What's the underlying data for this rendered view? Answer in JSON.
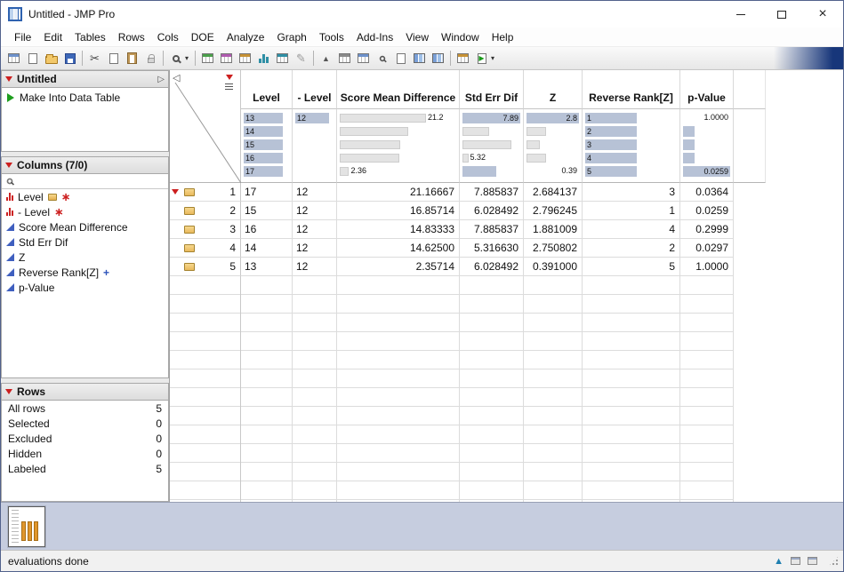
{
  "window": {
    "title": "Untitled - JMP Pro"
  },
  "menu": {
    "items": [
      "File",
      "Edit",
      "Tables",
      "Rows",
      "Cols",
      "DOE",
      "Analyze",
      "Graph",
      "Tools",
      "Add-Ins",
      "View",
      "Window",
      "Help"
    ]
  },
  "icons": {
    "cut": "✂",
    "pencil": "✎",
    "sort_up": "▲",
    "dropdown": "▾",
    "collapse_left": "◁",
    "expand_right": "▷",
    "close": "×",
    "status_up": "▲",
    "asterisk": "∗",
    "plus": "+",
    "play": "▶"
  },
  "toolbar": {
    "icon_names": [
      "new-data-table",
      "new-journal",
      "open-file",
      "save",
      "cut",
      "copy",
      "paste",
      "lock",
      "zoom",
      "zoom-dropdown",
      "data-table",
      "journal",
      "layout",
      "distribution",
      "fit-model",
      "draw-pencil",
      "sort-ascending",
      "table-view",
      "table-grid",
      "query-table",
      "copy-table",
      "sort-columns",
      "sort-columns-2",
      "formula",
      "run-script",
      "toolbar-options"
    ]
  },
  "sidebar": {
    "table_panel": {
      "title": "Untitled",
      "items": [
        {
          "label": "Make Into Data Table"
        }
      ]
    },
    "columns_panel": {
      "title": "Columns (7/0)",
      "search_placeholder": "",
      "items": [
        {
          "label": "Level",
          "type": "nominal",
          "badges": [
            "label-tag",
            "asterisk"
          ]
        },
        {
          "label": "- Level",
          "type": "nominal",
          "badges": [
            "asterisk"
          ]
        },
        {
          "label": "Score Mean Difference",
          "type": "continuous",
          "badges": []
        },
        {
          "label": "Std Err Dif",
          "type": "continuous",
          "badges": []
        },
        {
          "label": "Z",
          "type": "continuous",
          "badges": []
        },
        {
          "label": "Reverse Rank[Z]",
          "type": "continuous",
          "badges": [
            "formula-plus"
          ]
        },
        {
          "label": "p-Value",
          "type": "continuous",
          "badges": []
        }
      ]
    },
    "rows_panel": {
      "title": "Rows",
      "stats": [
        {
          "label": "All rows",
          "value": "5"
        },
        {
          "label": "Selected",
          "value": "0"
        },
        {
          "label": "Excluded",
          "value": "0"
        },
        {
          "label": "Hidden",
          "value": "0"
        },
        {
          "label": "Labeled",
          "value": "5"
        }
      ]
    }
  },
  "table": {
    "columns": [
      "Level",
      "- Level",
      "Score Mean Difference",
      "Std Err Dif",
      "Z",
      "Reverse Rank[Z]",
      "p-Value"
    ],
    "header_graph": {
      "level": [
        "13",
        "14",
        "15",
        "16",
        "17"
      ],
      "neg_level": [
        "12"
      ],
      "score": {
        "max": "21.2",
        "min": "2.36"
      },
      "stderr": {
        "max": "7.89",
        "min": "5.32"
      },
      "z": {
        "max": "2.8",
        "min": "0.39"
      },
      "reverse_rank": [
        "1",
        "2",
        "3",
        "4",
        "5"
      ],
      "pvalue": {
        "max": "1.0000",
        "min": "0.0259"
      }
    },
    "rows": [
      {
        "n": "1",
        "level": "17",
        "neg_level": "12",
        "score": "21.16667",
        "stderr": "7.885837",
        "z": "2.684137",
        "rank": "3",
        "p": "0.0364"
      },
      {
        "n": "2",
        "level": "15",
        "neg_level": "12",
        "score": "16.85714",
        "stderr": "6.028492",
        "z": "2.796245",
        "rank": "1",
        "p": "0.0259"
      },
      {
        "n": "3",
        "level": "16",
        "neg_level": "12",
        "score": "14.83333",
        "stderr": "7.885837",
        "z": "1.881009",
        "rank": "4",
        "p": "0.2999"
      },
      {
        "n": "4",
        "level": "14",
        "neg_level": "12",
        "score": "14.62500",
        "stderr": "5.316630",
        "z": "2.750802",
        "rank": "2",
        "p": "0.0297"
      },
      {
        "n": "5",
        "level": "13",
        "neg_level": "12",
        "score": "2.35714",
        "stderr": "6.028492",
        "z": "0.391000",
        "rank": "5",
        "p": "1.0000"
      }
    ]
  },
  "bottom": {
    "status": "evaluations done"
  }
}
